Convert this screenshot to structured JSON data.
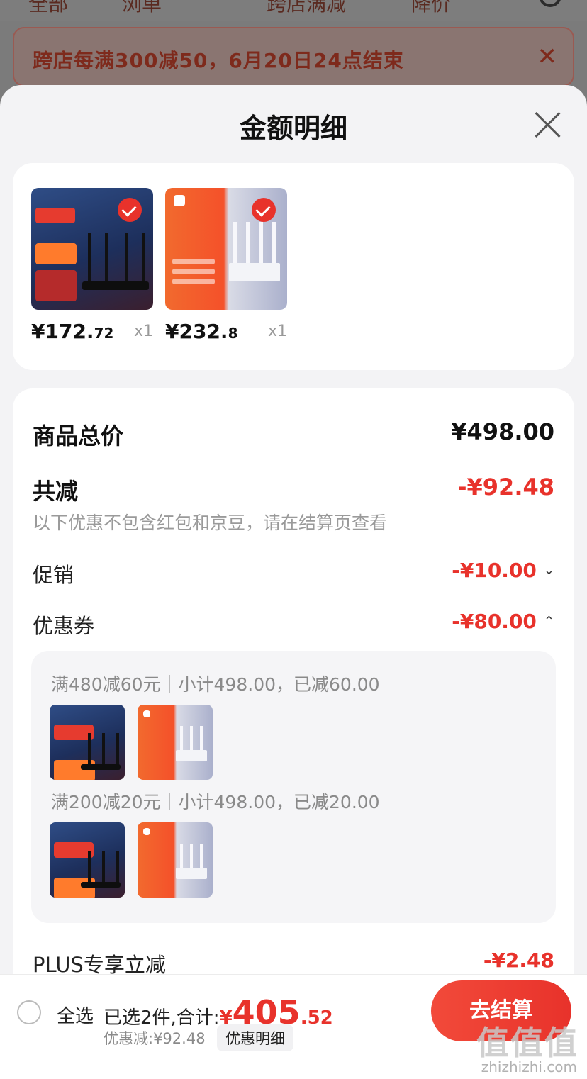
{
  "background": {
    "tabs": [
      "全部",
      "浏单",
      "跨店满减",
      "降价"
    ],
    "banner_text": "跨店每满300减50，6月20日24点结束",
    "banner_close": "✕"
  },
  "sheet": {
    "title": "金额明细"
  },
  "products": [
    {
      "name_icon": "ruijie-router",
      "price_int": "¥172.",
      "price_dec": "72",
      "qty": "x1",
      "checked": true
    },
    {
      "name_icon": "xiaomi-router",
      "price_int": "¥232.",
      "price_dec": "8",
      "qty": "x1",
      "checked": true
    }
  ],
  "detail": {
    "total_label": "商品总价",
    "total_value": "¥498.00",
    "reduce_label": "共减",
    "reduce_value": "-¥92.48",
    "note": "以下优惠不包含红包和京豆，请在结算页查看",
    "promo_label": "促销",
    "promo_value": "-¥10.00",
    "coupon_label": "优惠券",
    "coupon_value": "-¥80.00",
    "coupon_groups": [
      {
        "text": "满480减60元｜小计498.00，已减60.00"
      },
      {
        "text": "满200减20元｜小计498.00，已减20.00"
      }
    ],
    "plus_label": "PLUS专享立减",
    "plus_value": "-¥2.48"
  },
  "bottom": {
    "select_all": "全选",
    "summary_prefix": "已选2件,合计:",
    "currency": "¥",
    "total_int": "405",
    "total_dec": ".52",
    "discount": "优惠减:¥92.48",
    "detail_button": "优惠明细",
    "checkout_button": "去结算",
    "watermark": "值值值",
    "watermark_url": "zhizhizhi.com"
  },
  "colors": {
    "accent": "#e8322b",
    "sheet_bg": "#f3f3f5",
    "card_bg": "#ffffff"
  }
}
